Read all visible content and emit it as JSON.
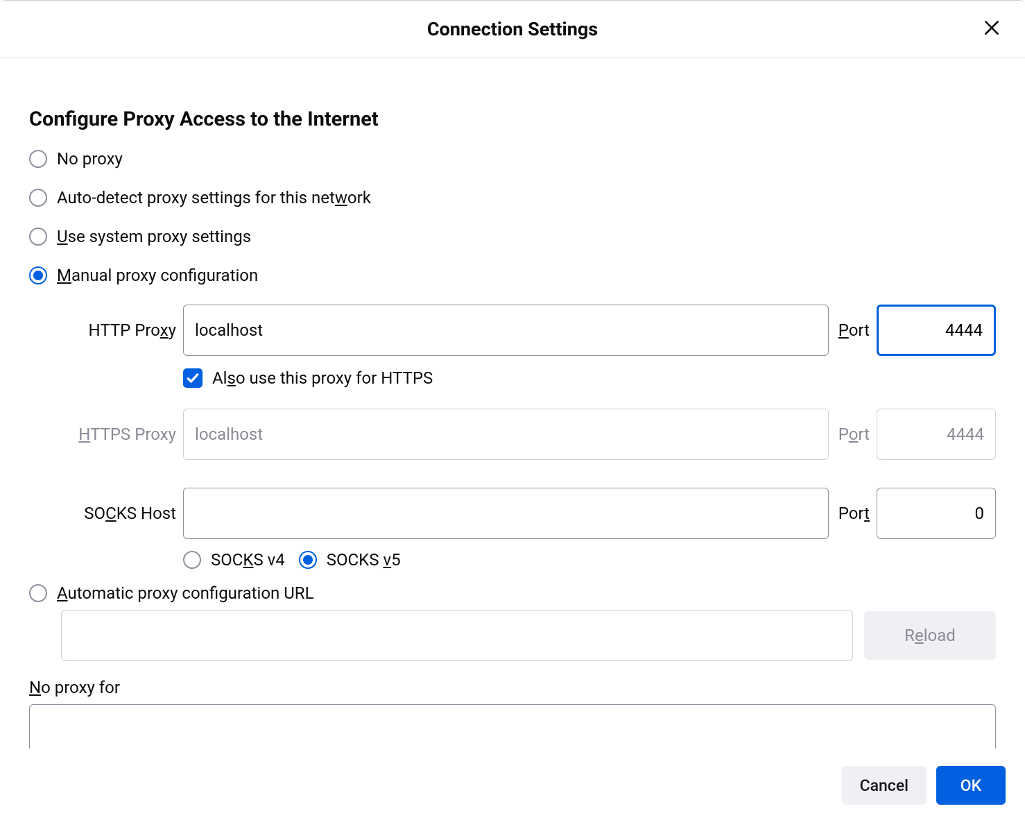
{
  "dialog": {
    "title": "Connection Settings",
    "section_title": "Configure Proxy Access to the Internet"
  },
  "radios": {
    "no_proxy": "No proxy",
    "auto_detect_pre": "Auto-detect proxy settings for this net",
    "auto_detect_u": "w",
    "auto_detect_post": "ork",
    "use_system_u": "U",
    "use_system_post": "se system proxy settings",
    "manual_u": "M",
    "manual_post": "anual proxy configuration",
    "auto_url_u": "A",
    "auto_url_post": "utomatic proxy configuration URL"
  },
  "http": {
    "label_pre": "HTTP Pro",
    "label_u": "x",
    "label_post": "y",
    "value": "localhost",
    "port_u": "P",
    "port_post": "ort",
    "port_value": "4444"
  },
  "also_https": {
    "pre": "Al",
    "u": "s",
    "post": "o use this proxy for HTTPS"
  },
  "https": {
    "label_u": "H",
    "label_post": "TTPS Proxy",
    "value": "localhost",
    "port_pre": "P",
    "port_u": "o",
    "port_post": "rt",
    "port_value": "4444"
  },
  "socks": {
    "label_pre": "SO",
    "label_u": "C",
    "label_post": "KS Host",
    "value": "",
    "port_pre": "Por",
    "port_u": "t",
    "port_value": "0",
    "v4_pre": "SOC",
    "v4_u": "K",
    "v4_post": "S v4",
    "v5_pre": "SOCKS ",
    "v5_u": "v",
    "v5_post": "5"
  },
  "reload": {
    "pre": "R",
    "u": "e",
    "post": "load"
  },
  "no_proxy_for": {
    "u": "N",
    "post": "o proxy for"
  },
  "footer": {
    "cancel": "Cancel",
    "ok": "OK"
  }
}
